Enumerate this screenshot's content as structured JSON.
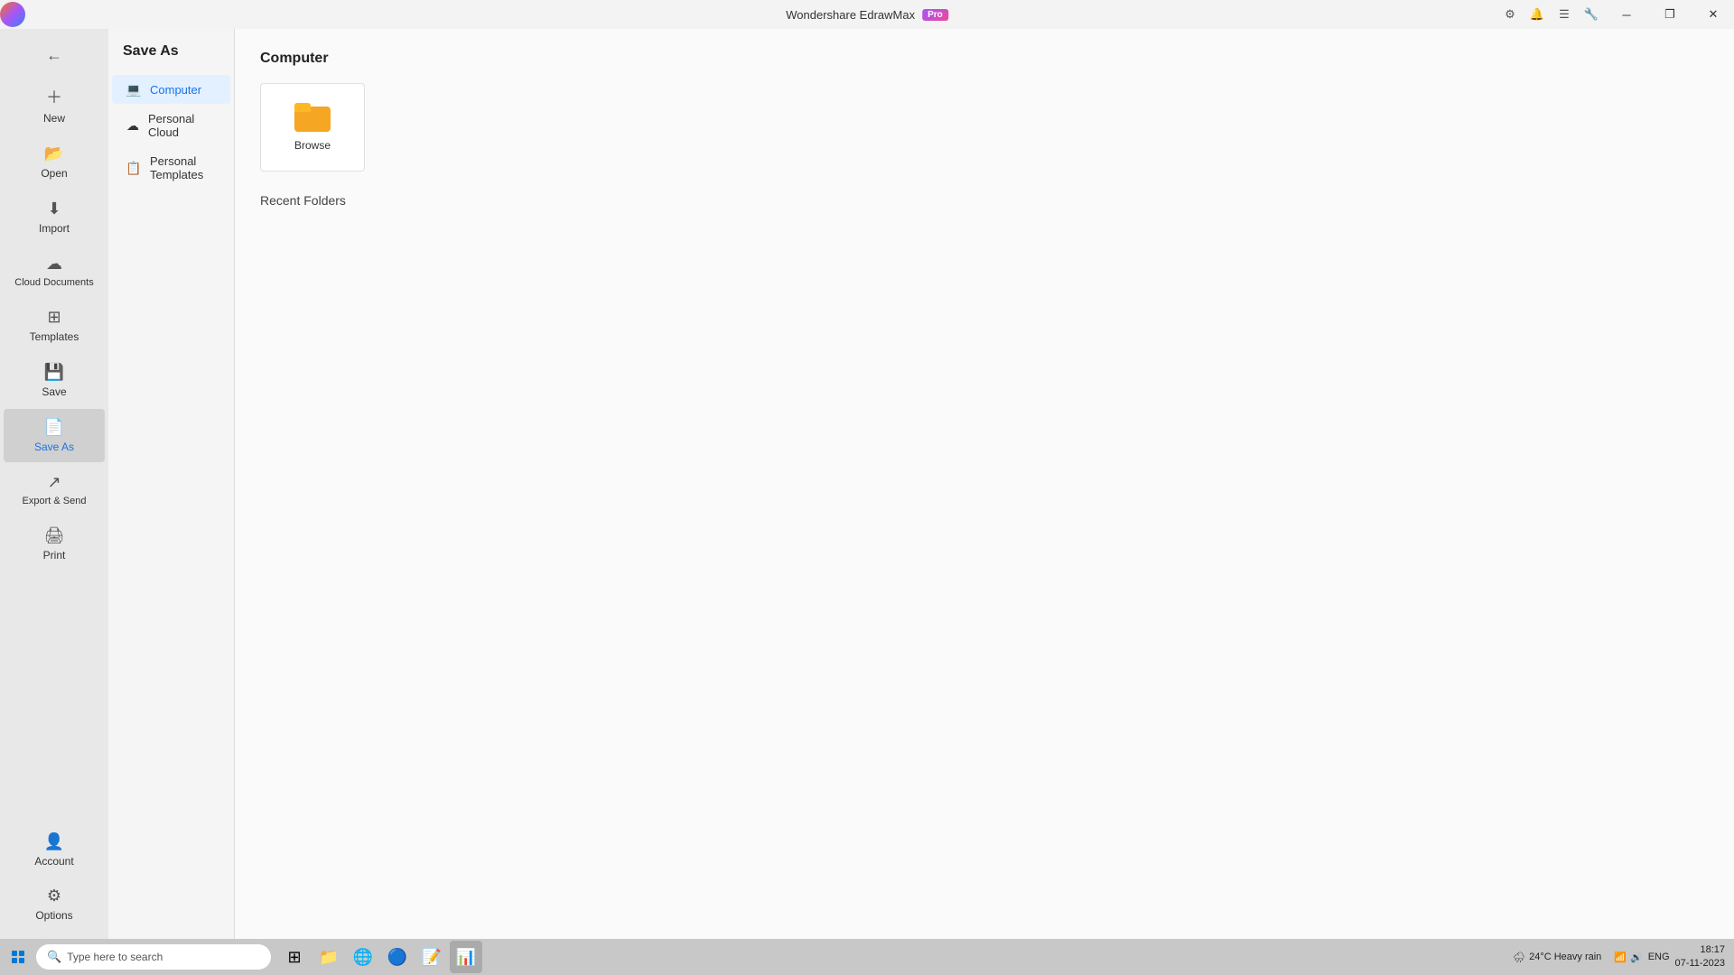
{
  "app": {
    "title": "Wondershare EdrawMax",
    "badge": "Pro"
  },
  "titlebar": {
    "minimize": "─",
    "restore": "❐",
    "close": "✕"
  },
  "left_sidebar": {
    "items": [
      {
        "id": "back",
        "label": "",
        "icon": "←"
      },
      {
        "id": "new",
        "label": "New",
        "icon": "+"
      },
      {
        "id": "open",
        "label": "Open",
        "icon": "📂"
      },
      {
        "id": "import",
        "label": "Import",
        "icon": "⬇"
      },
      {
        "id": "cloud-documents",
        "label": "Cloud Documents",
        "icon": "☁"
      },
      {
        "id": "templates",
        "label": "Templates",
        "icon": "⊞"
      },
      {
        "id": "save",
        "label": "Save",
        "icon": "💾"
      },
      {
        "id": "save-as",
        "label": "Save As",
        "icon": "📄"
      },
      {
        "id": "export-send",
        "label": "Export & Send",
        "icon": "↗"
      },
      {
        "id": "print",
        "label": "Print",
        "icon": "🖨"
      }
    ],
    "bottom_items": [
      {
        "id": "account",
        "label": "Account",
        "icon": "👤"
      },
      {
        "id": "options",
        "label": "Options",
        "icon": "⚙"
      }
    ]
  },
  "middle_panel": {
    "title": "Save As",
    "items": [
      {
        "id": "computer",
        "label": "Computer",
        "active": true,
        "icon": "💻"
      },
      {
        "id": "personal-cloud",
        "label": "Personal Cloud",
        "icon": "☁"
      },
      {
        "id": "personal-templates",
        "label": "Personal Templates",
        "icon": "📋"
      }
    ]
  },
  "content": {
    "title": "Computer",
    "browse_label": "Browse",
    "recent_folders_label": "Recent Folders"
  },
  "taskbar": {
    "search_placeholder": "Type here to search",
    "weather": "24°C  Heavy rain",
    "time": "18:17",
    "date": "07-11-2023",
    "language": "ENG"
  }
}
